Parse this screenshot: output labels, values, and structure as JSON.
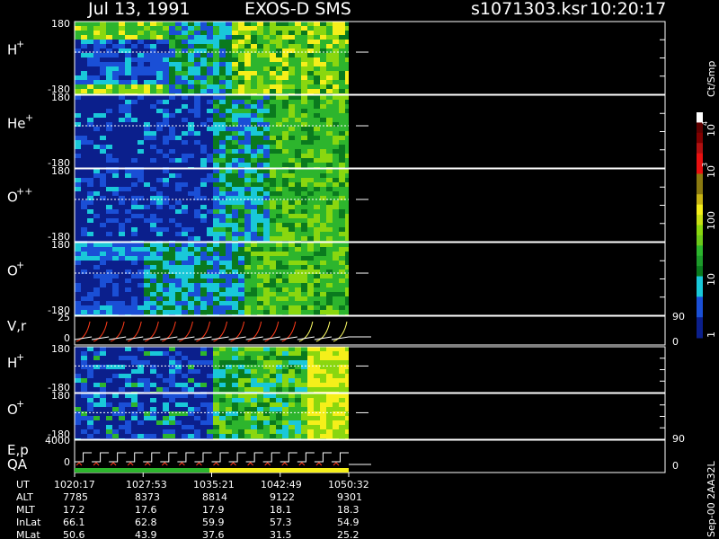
{
  "header": {
    "date": "Jul 13, 1991",
    "instrument": "EXOS-D SMS",
    "file": "s1071303.ksr",
    "time": "10:20:17"
  },
  "colorbar": {
    "unit": "Ct/Smp",
    "labels": [
      "1",
      "10",
      "100",
      "10",
      "10"
    ],
    "exponents": [
      "3",
      "4"
    ]
  },
  "footer_tag": "Sep-00 2AA32L",
  "colors": {
    "navy": "#0b1f8c",
    "blue": "#1a4fd6",
    "cyan": "#19c8d9",
    "darkgreen": "#0a7a1e",
    "green": "#2db52d",
    "lime": "#8ad70f",
    "yellow": "#f5ef1a",
    "olive": "#8b7a10",
    "red": "#e81010",
    "darkred": "#800000"
  },
  "chart_data": [
    {
      "type": "heatmap",
      "panel": "H+",
      "label_base": "H",
      "label_sup": "+",
      "yticks": [
        "180",
        "-180"
      ]
    },
    {
      "type": "heatmap",
      "panel": "He+",
      "label_base": "He",
      "label_sup": "+",
      "yticks": [
        "180",
        "-180"
      ]
    },
    {
      "type": "heatmap",
      "panel": "O++",
      "label_base": "O",
      "label_sup": "++",
      "yticks": [
        "180",
        "-180"
      ]
    },
    {
      "type": "heatmap",
      "panel": "O+",
      "label_base": "O",
      "label_sup": "+",
      "yticks": [
        "180",
        "-180"
      ]
    },
    {
      "type": "line",
      "panel": "V,r",
      "label": "V,r",
      "yticks": [
        "25",
        "0"
      ],
      "right_ticks": [
        "90",
        "0"
      ]
    },
    {
      "type": "heatmap",
      "panel": "H+ (2)",
      "label_base": "H",
      "label_sup": "+",
      "yticks": [
        "180",
        "-180"
      ]
    },
    {
      "type": "heatmap",
      "panel": "O+ (2)",
      "label_base": "O",
      "label_sup": "+",
      "yticks": [
        "180",
        "-180"
      ]
    },
    {
      "type": "line",
      "panel": "E,p QA",
      "label1": "E,p",
      "label2": "QA",
      "yticks": [
        "4000",
        "0"
      ],
      "right_ticks": [
        "90",
        "0"
      ]
    }
  ],
  "orbit_table": {
    "rows": [
      {
        "label": "UT",
        "values": [
          "1020:17",
          "1027:53",
          "1035:21",
          "1042:49",
          "1050:32"
        ]
      },
      {
        "label": "ALT",
        "values": [
          "7785",
          "8373",
          "8814",
          "9122",
          "9301"
        ]
      },
      {
        "label": "MLT",
        "values": [
          "17.2",
          "17.6",
          "17.9",
          "18.1",
          "18.3"
        ]
      },
      {
        "label": "InLat",
        "values": [
          "66.1",
          "62.8",
          "59.9",
          "57.3",
          "54.9"
        ]
      },
      {
        "label": "MLat",
        "values": [
          "50.6",
          "43.9",
          "37.6",
          "31.5",
          "25.2"
        ]
      }
    ]
  }
}
